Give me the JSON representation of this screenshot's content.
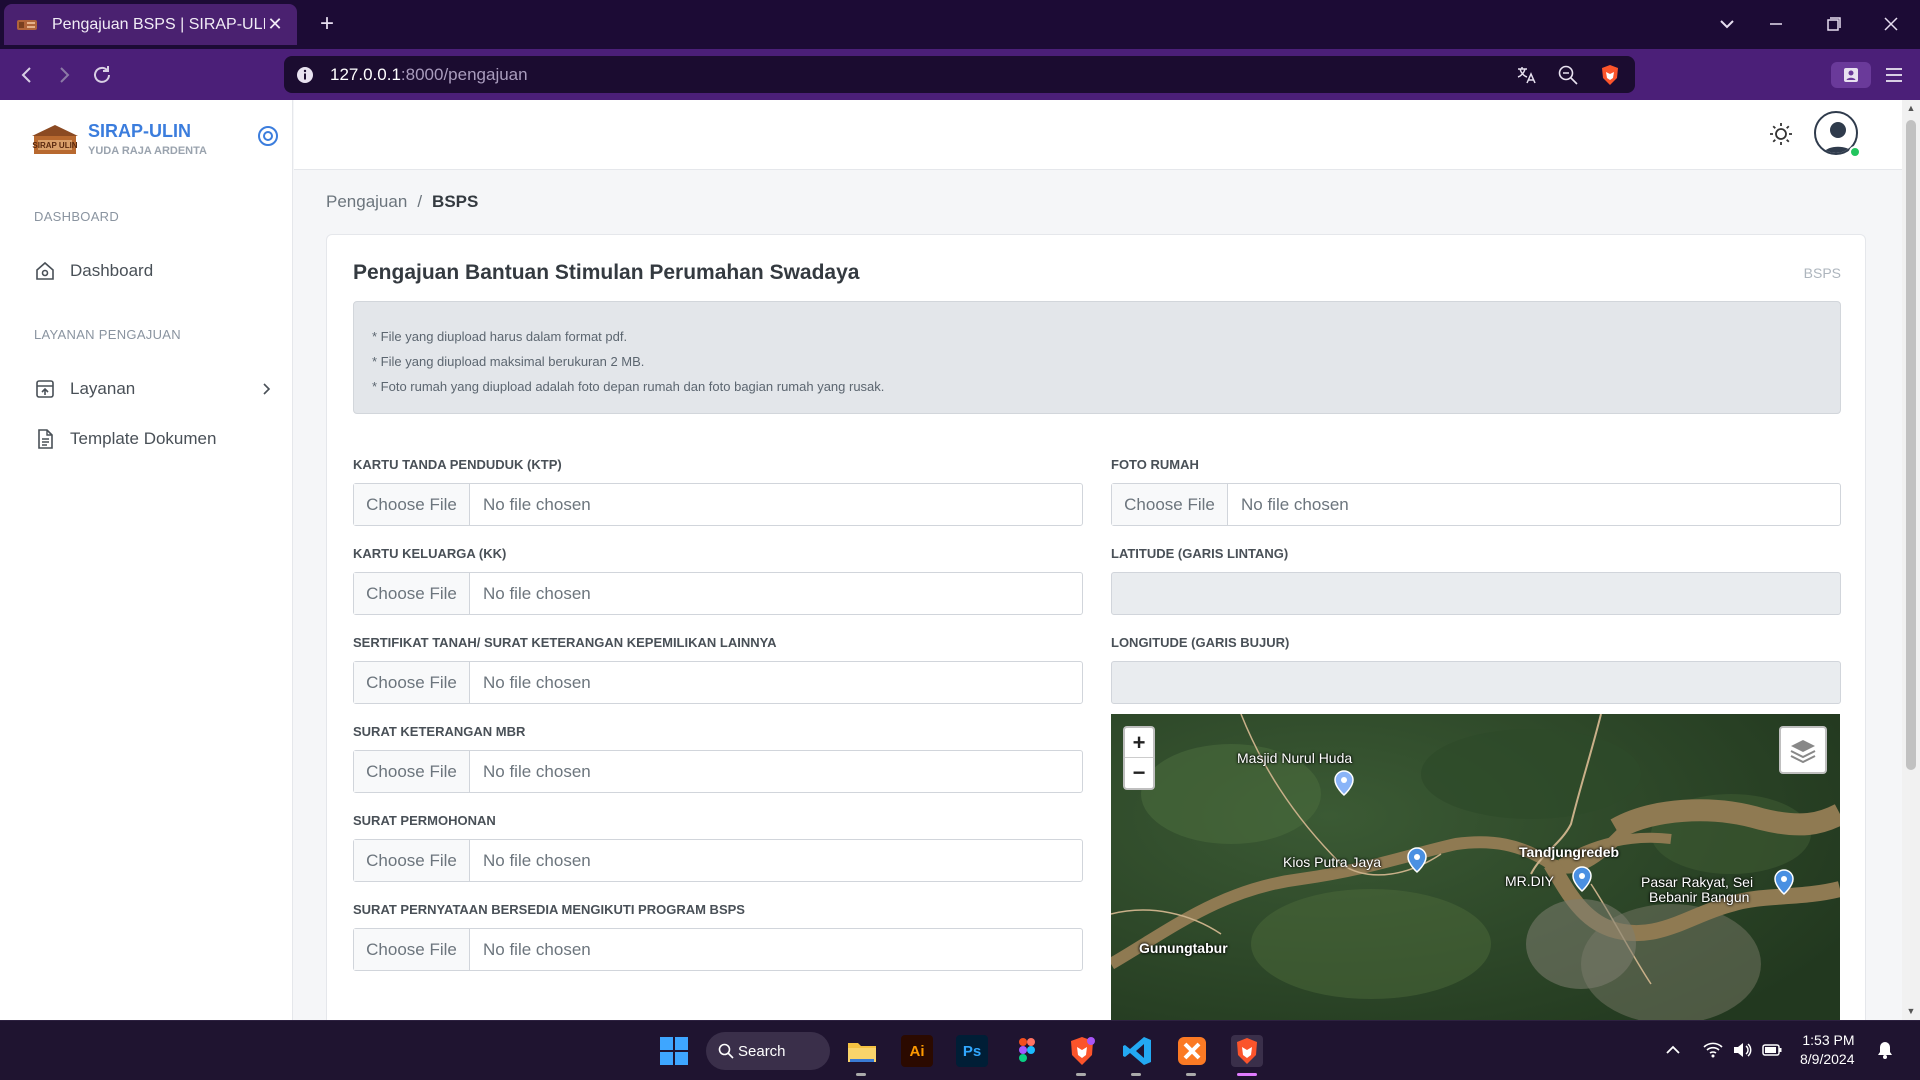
{
  "browser": {
    "tab_title": "Pengajuan BSPS | SIRAP-ULIN",
    "url_host": "127.0.0.1",
    "url_path": ":8000/pengajuan"
  },
  "sidebar": {
    "brand_title": "SIRAP-ULIN",
    "brand_sub": "YUDA RAJA ARDENTA",
    "logo_text": "SIRAP ULIN",
    "heading_dashboard": "DASHBOARD",
    "heading_layanan": "LAYANAN PENGAJUAN",
    "items": [
      {
        "label": "Dashboard",
        "icon": "home-icon"
      },
      {
        "label": "Layanan",
        "icon": "upload-box-icon"
      },
      {
        "label": "Template Dokumen",
        "icon": "document-icon"
      }
    ]
  },
  "breadcrumb": {
    "parent": "Pengajuan",
    "separator": "/",
    "current": "BSPS"
  },
  "card": {
    "title": "Pengajuan Bantuan Stimulan Perumahan Swadaya",
    "tag": "BSPS",
    "notes": [
      "* File yang diupload harus dalam format pdf.",
      "* File yang diupload maksimal berukuran 2 MB.",
      "* Foto rumah yang diupload adalah foto depan rumah dan foto bagian rumah yang rusak."
    ]
  },
  "form": {
    "choose_label": "Choose File",
    "no_file_label": "No file chosen",
    "left_fields": [
      "KARTU TANDA PENDUDUK (KTP)",
      "KARTU KELUARGA (KK)",
      "SERTIFIKAT TANAH/ SURAT KETERANGAN KEPEMILIKAN LAINNYA",
      "SURAT KETERANGAN MBR",
      "SURAT PERMOHONAN",
      "SURAT PERNYATAAN BERSEDIA MENGIKUTI PROGRAM BSPS"
    ],
    "foto_rumah": "FOTO RUMAH",
    "latitude": "LATITUDE (GARIS LINTANG)",
    "longitude": "LONGITUDE (GARIS BUJUR)"
  },
  "map": {
    "zoom_in": "+",
    "zoom_out": "−",
    "labels": {
      "masjid": "Masjid Nurul Huda",
      "kios": "Kios Putra Jaya",
      "tandjung": "Tandjungredeb",
      "mrdiy": "MR.DIY",
      "pasar_1": "Pasar Rakyat, Sei",
      "pasar_2": "Bebanir Bangun",
      "gunung": "Gunungtabur"
    }
  },
  "taskbar": {
    "search_label": "Search",
    "ai_label": "Ai",
    "ps_label": "Ps",
    "time": "1:53 PM",
    "date": "8/9/2024"
  },
  "colors": {
    "brand": "#3b7ddd",
    "browser_tabbar": "#1c0b35",
    "browser_navbar": "#4b1f78",
    "online": "#22c55e"
  }
}
